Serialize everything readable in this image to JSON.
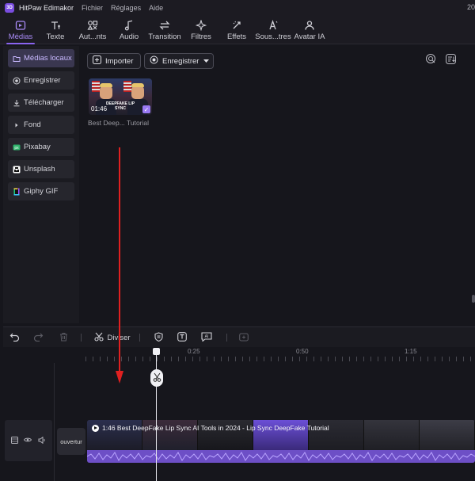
{
  "titlebar": {
    "app_name": "HitPaw Edimakor",
    "menu": [
      "Fichier",
      "Réglages",
      "Aide"
    ],
    "clock_fragment": "20"
  },
  "toolbar": {
    "tools": [
      {
        "label": "Médias",
        "icon": "media-icon",
        "active": true
      },
      {
        "label": "Texte",
        "icon": "text-icon",
        "active": false
      },
      {
        "label": "Aut...nts",
        "icon": "auto-elements-icon",
        "active": false
      },
      {
        "label": "Audio",
        "icon": "music-note-icon",
        "active": false
      },
      {
        "label": "Transition",
        "icon": "transition-icon",
        "active": false
      },
      {
        "label": "Filtres",
        "icon": "sparkle-icon",
        "active": false
      },
      {
        "label": "Effets",
        "icon": "effects-icon",
        "active": false
      },
      {
        "label": "Sous...tres",
        "icon": "subtitle-icon",
        "active": false
      },
      {
        "label": "Avatar IA",
        "icon": "avatar-icon",
        "active": false
      }
    ]
  },
  "sidebar": {
    "items": [
      {
        "label": "Médias locaux",
        "icon": "folder-icon",
        "active": true
      },
      {
        "label": "Enregistrer",
        "icon": "record-icon",
        "active": false
      },
      {
        "label": "Télécharger",
        "icon": "download-icon",
        "active": false
      },
      {
        "label": "Fond",
        "icon": "caret-right-icon",
        "active": false
      },
      {
        "label": "Pixabay",
        "icon": "pixabay-icon",
        "active": false
      },
      {
        "label": "Unsplash",
        "icon": "unsplash-icon",
        "active": false
      },
      {
        "label": "Giphy GIF",
        "icon": "giphy-icon",
        "active": false
      }
    ]
  },
  "media": {
    "import_label": "Importer",
    "record_label": "Enregistrer",
    "items": [
      {
        "title": "Best Deep... Tutorial",
        "duration": "01:46",
        "caption": "DEEPFAKE LIP SYNC",
        "selected": true
      }
    ]
  },
  "timeline": {
    "split_label": "Diviser",
    "ruler_labels": [
      "0:25",
      "0:50",
      "1:15"
    ],
    "cover_label": "ouvertur",
    "clip_title": "1:46 Best DeepFake Lip Sync AI Tools in 2024 - Lip Sync DeepFake Tutorial"
  },
  "colors": {
    "accent": "#8a64f0",
    "accent_text": "#a98bf7",
    "annotation_arrow": "#e02020",
    "audio_wave": "#6d4fc6"
  }
}
